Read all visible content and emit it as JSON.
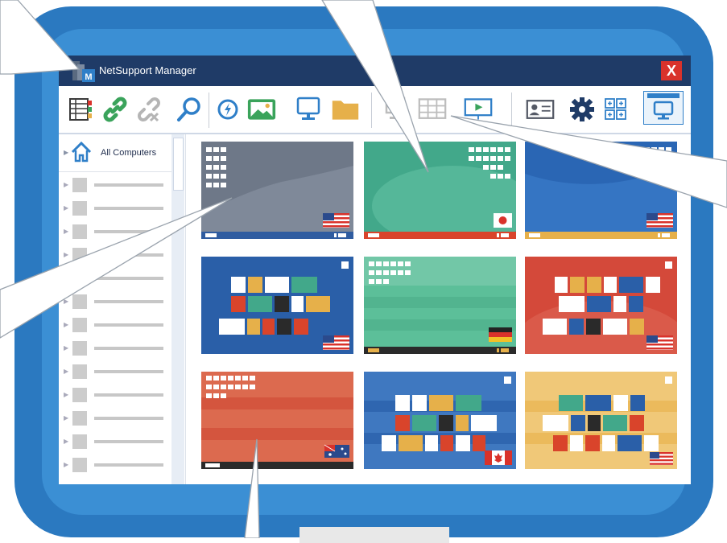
{
  "window": {
    "title": "NetSupport Manager",
    "close_label": "X"
  },
  "sidebar": {
    "root_label": "All Computers",
    "item_count_visible": 13
  },
  "toolbar": {
    "icons": [
      "grid-list-icon",
      "link-icon",
      "unlink-icon",
      "search-icon",
      "quick-connect-icon",
      "image-icon",
      "monitor-icon",
      "folder-icon",
      "disabled-monitor-icon",
      "disabled-grid-icon",
      "presentation-icon",
      "user-card-icon",
      "gear-icon",
      "tiles-icon",
      "screen-view-icon"
    ]
  },
  "colors": {
    "title_bar": "#1f3b67",
    "monitor_frame": "#2b79c0",
    "close_button": "#d9322b"
  },
  "thumbnails": [
    {
      "name": "thumb-grey-us",
      "flag": "US"
    },
    {
      "name": "thumb-green-jp",
      "flag": "JP"
    },
    {
      "name": "thumb-blue-us",
      "flag": "US"
    },
    {
      "name": "thumb-blue-tiles-us",
      "flag": "US"
    },
    {
      "name": "thumb-green-de",
      "flag": "DE"
    },
    {
      "name": "thumb-red-tiles-us",
      "flag": "US"
    },
    {
      "name": "thumb-red-au",
      "flag": "AU"
    },
    {
      "name": "thumb-blue-tiles-ca",
      "flag": "CA"
    },
    {
      "name": "thumb-yellow-tiles-us",
      "flag": "US"
    }
  ]
}
